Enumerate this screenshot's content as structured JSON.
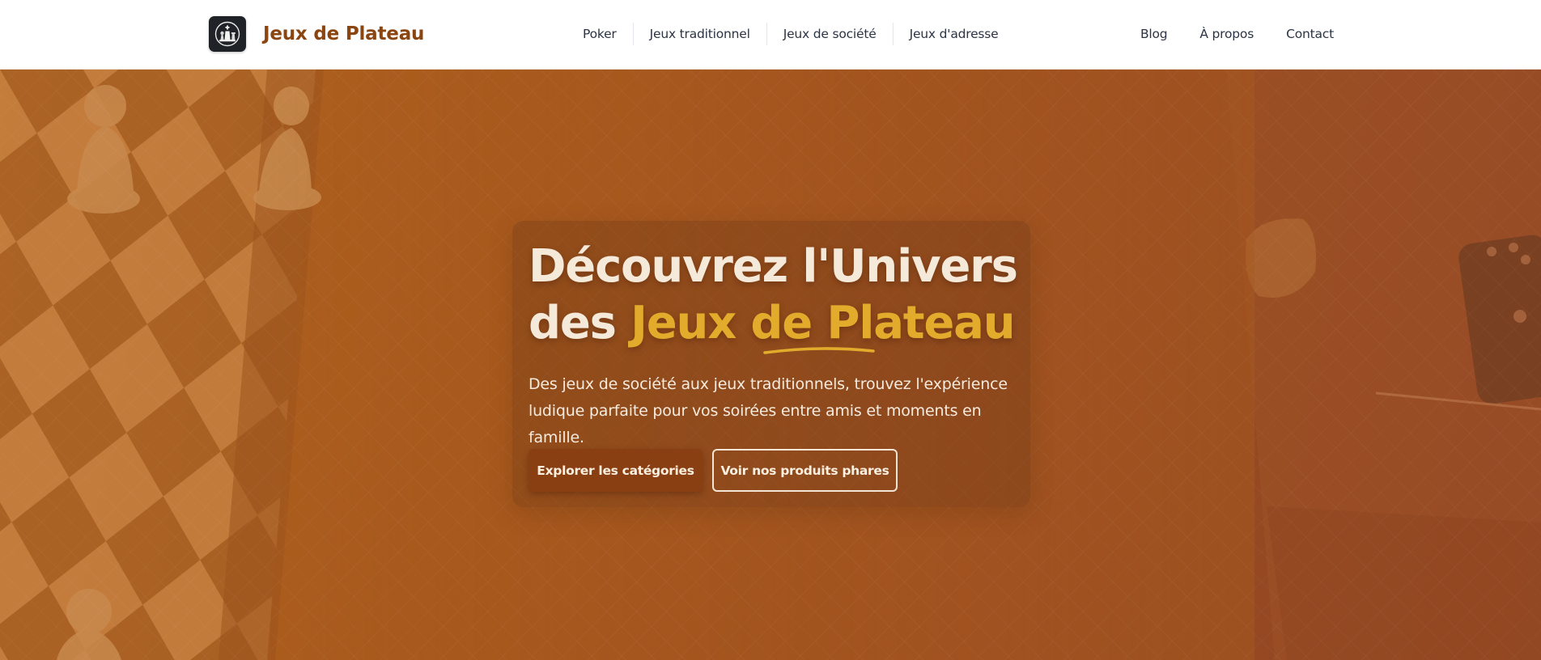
{
  "header": {
    "site_title": "Jeux de Plateau",
    "logo_icon": "chess-pieces-icon",
    "nav_main": [
      "Poker",
      "Jeux traditionnel",
      "Jeux de société",
      "Jeux d'adresse"
    ],
    "nav_secondary": [
      "Blog",
      "À propos",
      "Contact"
    ]
  },
  "hero": {
    "title_line1": "Découvrez l'Univers",
    "title_line2_prefix": "des ",
    "title_line2_accent": "Jeux de Plateau",
    "subtitle": "Des jeux de société aux jeux traditionnels, trouvez l'expérience ludique parfaite pour vos soirées entre amis et moments en famille.",
    "primary_button": "Explorer les catégories",
    "secondary_button": "Voir nos produits phares"
  },
  "colors": {
    "brand": "#8a4510",
    "accent": "#e2ab2c",
    "hero_overlay": "#a6571d",
    "primary_button": "#8a3f12"
  }
}
